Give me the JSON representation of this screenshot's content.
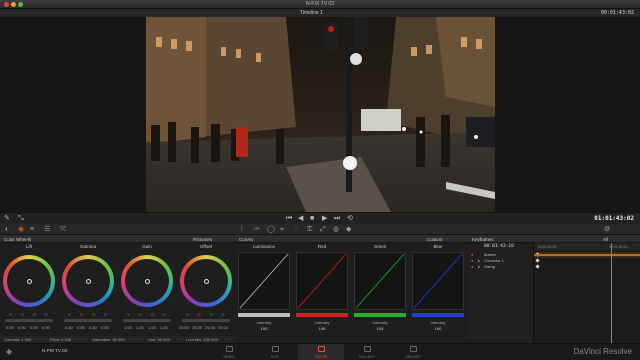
{
  "window": {
    "title": "N-PIX TV 03"
  },
  "viewer": {
    "timeline_name": "Timeline 1",
    "timecode_top": "00:01:43:02"
  },
  "transport": {
    "timecode": "01:01:43:02"
  },
  "panels": {
    "color_wheels": "Color Wheels",
    "primaries": "Primaries",
    "curves": "Curves",
    "custom": "Custom",
    "keyframes": "Keyframes",
    "all": "All"
  },
  "wheels": [
    {
      "label": "Lift",
      "vals": [
        "0.00",
        "0.00",
        "0.00",
        "0.00"
      ]
    },
    {
      "label": "Gamma",
      "vals": [
        "0.00",
        "0.00",
        "0.00",
        "0.00"
      ]
    },
    {
      "label": "Gain",
      "vals": [
        "1.00",
        "1.00",
        "1.00",
        "1.00"
      ]
    },
    {
      "label": "Offset",
      "vals": [
        "25.00",
        "25.00",
        "25.00",
        "25.00"
      ]
    }
  ],
  "wheel_channels": [
    "Y",
    "R",
    "G",
    "B"
  ],
  "wheel_footer": {
    "contrast": "Contrast: 1.000",
    "pivot": "Pivot: 0.435",
    "saturation": "Saturation: 50.000",
    "hue": "Hue: 50.000",
    "lum_mix": "Lum Mix: 100.000"
  },
  "curves": [
    {
      "label": "Luminance",
      "intensity_label": "Intensity",
      "intensity": "100",
      "color": "#bbbbbb"
    },
    {
      "label": "Red",
      "intensity_label": "Intensity",
      "intensity": "100",
      "color": "#d02020"
    },
    {
      "label": "Green",
      "intensity_label": "Intensity",
      "intensity": "100",
      "color": "#20b030"
    },
    {
      "label": "Blue",
      "intensity_label": "Intensity",
      "intensity": "100",
      "color": "#2040d0"
    }
  ],
  "keyframes": {
    "timecode": "00:01:43:18",
    "ruler_start": "00:00:00:00",
    "ruler_end": "00:01:52:13",
    "rows": [
      "Master",
      "Corrector 1",
      "Sizing"
    ]
  },
  "bottom": {
    "project": "N-PIX TV 03",
    "pages": [
      "MEDIA",
      "EDIT",
      "COLOR",
      "GALLERY",
      "DELIVER"
    ],
    "active_page": "COLOR",
    "brand": "DaVinci Resolve"
  },
  "colors": {
    "accent": "#e05030",
    "playhead": "#d07020"
  }
}
